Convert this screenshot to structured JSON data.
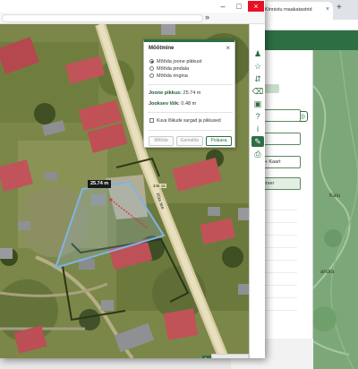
{
  "background_window": {
    "tab_title": "Kinnistu maakatastrid",
    "tab_close": "×",
    "new_tab": "+",
    "map_labels": [
      "Kaiu",
      "andra"
    ],
    "panel_fields": [
      "",
      "",
      "d + Kaart",
      "server"
    ]
  },
  "window_controls": {
    "minimize": "–",
    "maximize": "□",
    "close": "×"
  },
  "address_bar": {
    "chevron": "»"
  },
  "dialog": {
    "title": "Mõõtmine",
    "close": "×",
    "options": [
      {
        "label": "Mõõda joone pikkust",
        "selected": true
      },
      {
        "label": "Mõõda pindala",
        "selected": false
      },
      {
        "label": "Mõõda ringina",
        "selected": false
      }
    ],
    "length_label": "Joone pikkus:",
    "length_value": "25.74 m",
    "last_segment_label": "Jooksev lõik:",
    "last_segment_value": "0.48 m",
    "checkbox_label": "Kuva lõikude surgad ja pikkused",
    "buttons": {
      "measure": "Mõõda",
      "clear": "Eemalda",
      "close": "Polaasa"
    }
  },
  "map": {
    "measure_label": "25.74 m",
    "road_number": "446 16",
    "road_number_2": "446 16",
    "road_name": "Rita tee"
  },
  "toolbar_icons": [
    "person-icon",
    "star-icon",
    "layers-arrows-icon",
    "eraser-icon",
    "comment-icon",
    "help-icon",
    "info-icon",
    "ruler-icon",
    "print-icon"
  ],
  "colors": {
    "brand_green": "#2e6e43",
    "measure_line": "#d93333",
    "parcel_outline": "#7fb4e3"
  }
}
